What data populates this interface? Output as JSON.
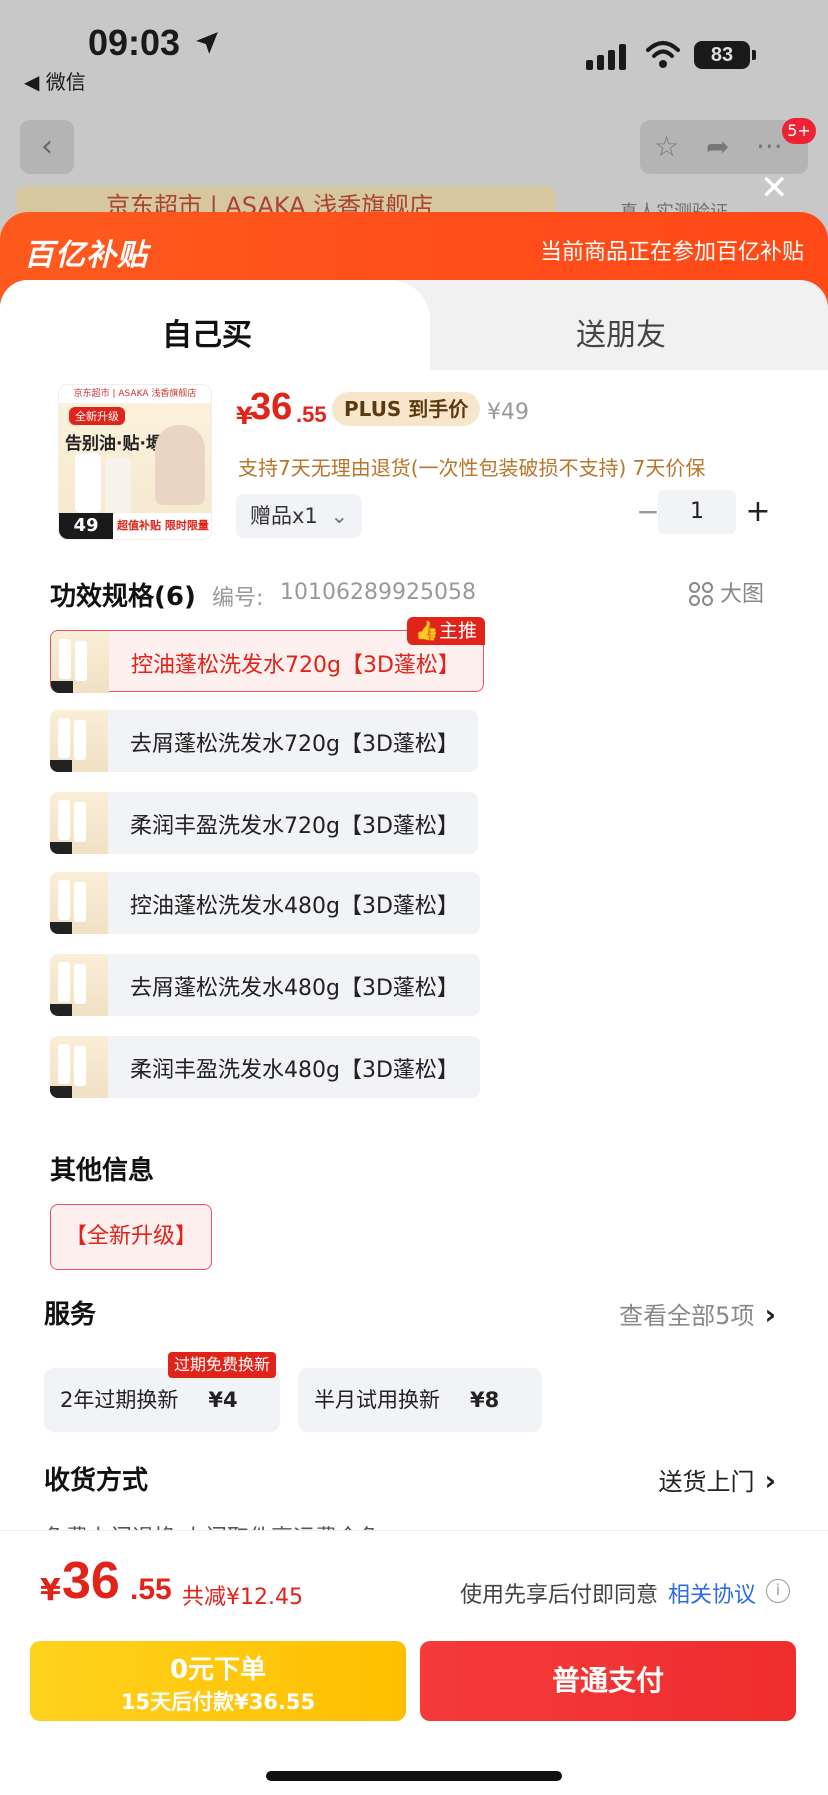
{
  "status_bar": {
    "time": "09:03",
    "back_app": "◀ 微信",
    "battery": "83"
  },
  "background": {
    "nav_badge": "5+",
    "shop_name": "京东超市 | ASAKA 浅香旗舰店",
    "side_text": "真人实测验证"
  },
  "banner": {
    "logo": "百亿补贴",
    "text": "当前商品正在参加百亿补贴"
  },
  "tabs": {
    "self": "自己买",
    "gift": "送朋友"
  },
  "product": {
    "image": {
      "top_text": "京东超市 | ASAKA 浅香旗舰店",
      "tag": "全新升级",
      "title": "告别油·贴·塌",
      "price": "49",
      "sub": "超值补贴 限时限量"
    },
    "currency": "¥",
    "price_int": "36",
    "price_dec": ".55",
    "plus_label": "PLUS 到手价",
    "original_price": "¥49",
    "return_policy": "支持7天无理由退货(一次性包装破损不支持) 7天价保",
    "gift": "赠品x1",
    "quantity_minus": "−",
    "quantity": "1",
    "quantity_plus": "+"
  },
  "specs": {
    "title": "功效规格(6)",
    "code_label": "编号:",
    "code": "10106289925058",
    "big_image": "大图",
    "main_badge": "主推",
    "items": [
      {
        "label": "控油蓬松洗发水720g【3D蓬松】"
      },
      {
        "label": "去屑蓬松洗发水720g【3D蓬松】"
      },
      {
        "label": "柔润丰盈洗发水720g【3D蓬松】"
      },
      {
        "label": "控油蓬松洗发水480g【3D蓬松】"
      },
      {
        "label": "去屑蓬松洗发水480g【3D蓬松】"
      },
      {
        "label": "柔润丰盈洗发水480g【3D蓬松】"
      }
    ]
  },
  "other": {
    "title": "其他信息",
    "tag": "【全新升级】"
  },
  "service": {
    "title": "服务",
    "view_all": "查看全部5项",
    "badge": "过期免费换新",
    "cards": [
      {
        "name": "2年过期换新",
        "price": "¥4"
      },
      {
        "name": "半月试用换新",
        "price": "¥8"
      }
    ]
  },
  "delivery": {
    "title": "收货方式",
    "value": "送货上门",
    "cut_row": "免费上门退换 上门取件享运费全免"
  },
  "bottom": {
    "currency": "¥",
    "total_int": "36",
    "total_dec": ".55",
    "discount": "共减¥12.45",
    "agree_text": "使用先享后付即同意",
    "agree_link": "相关协议",
    "info_icon": "i",
    "bnpl_line1": "0元下单",
    "bnpl_line2": "15天后付款¥36.55",
    "pay_label": "普通支付"
  },
  "colors": {
    "accent_red": "#e2231a",
    "banner_orange": "#ff5a1e",
    "bnpl_yellow": "#ffc400",
    "link_blue": "#2b6de8"
  }
}
